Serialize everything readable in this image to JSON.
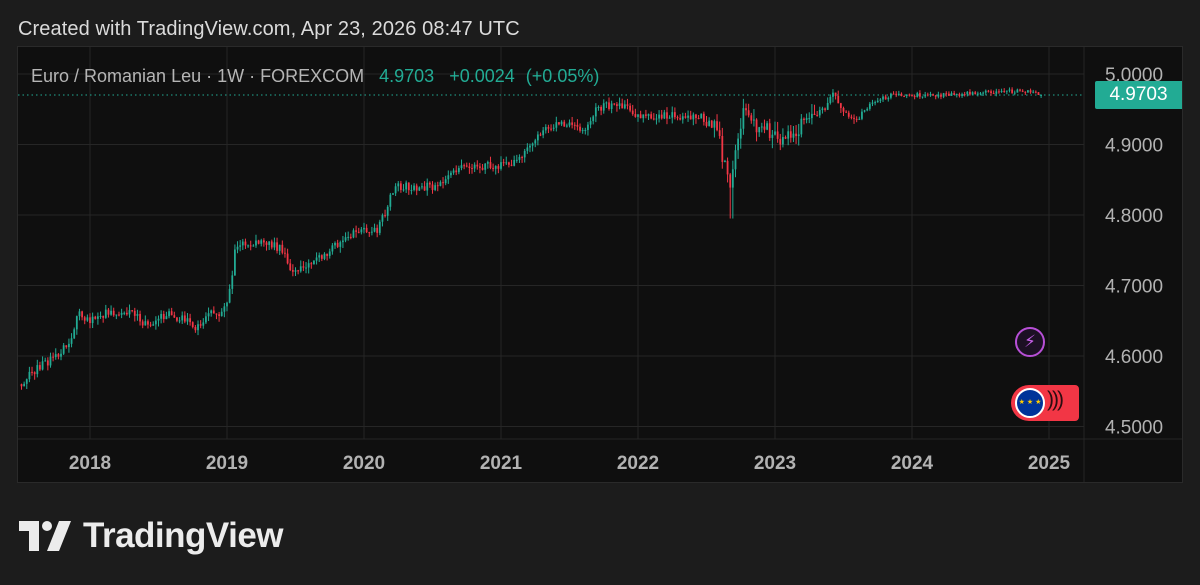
{
  "caption": "Created with TradingView.com, Apr 23, 2026 08:47 UTC",
  "legend": {
    "symbol": "Euro / Romanian Leu · 1W · FOREXCOM",
    "price": "4.9703",
    "change": "+0.0024",
    "change_pct": "(+0.05%)"
  },
  "last_price_label": "4.9703",
  "brand": "TradingView",
  "colors": {
    "up": "#22ab94",
    "down": "#f23645",
    "grid": "#262626",
    "axis_text": "#b2b2b2",
    "panel": "#0f0f0f",
    "page": "#1c1c1c"
  },
  "icons": [
    "lightning-bolt-icon",
    "eu-flag-icon",
    "tradingview-logo-icon"
  ],
  "chart_data": {
    "type": "candlestick",
    "title": "Euro / Romanian Leu",
    "interval": "1W",
    "source": "FOREXCOM",
    "ylim": [
      4.48,
      5.02
    ],
    "y_ticks": [
      4.5,
      4.6,
      4.7,
      4.8,
      4.9,
      5.0
    ],
    "y_tick_labels": [
      "4.5000",
      "4.6000",
      "4.7000",
      "4.8000",
      "4.9000",
      "5.0000"
    ],
    "x_range": [
      2017.48,
      2025.45
    ],
    "x_ticks": [
      2018,
      2019,
      2020,
      2021,
      2022,
      2023,
      2024,
      2025
    ],
    "x_tick_labels": [
      "2018",
      "2019",
      "2020",
      "2021",
      "2022",
      "2023",
      "2024",
      "2025"
    ],
    "last_price": 4.9703,
    "grid": true,
    "price_path": [
      [
        2017.5,
        4.56
      ],
      [
        2017.6,
        4.58
      ],
      [
        2017.75,
        4.6
      ],
      [
        2017.85,
        4.62
      ],
      [
        2017.92,
        4.66
      ],
      [
        2018.0,
        4.65
      ],
      [
        2018.1,
        4.66
      ],
      [
        2018.3,
        4.66
      ],
      [
        2018.45,
        4.64
      ],
      [
        2018.55,
        4.66
      ],
      [
        2018.7,
        4.65
      ],
      [
        2018.78,
        4.64
      ],
      [
        2018.88,
        4.66
      ],
      [
        2018.96,
        4.66
      ],
      [
        2019.02,
        4.69
      ],
      [
        2019.06,
        4.75
      ],
      [
        2019.12,
        4.76
      ],
      [
        2019.3,
        4.76
      ],
      [
        2019.42,
        4.75
      ],
      [
        2019.47,
        4.72
      ],
      [
        2019.6,
        4.73
      ],
      [
        2019.75,
        4.75
      ],
      [
        2019.88,
        4.77
      ],
      [
        2020.05,
        4.78
      ],
      [
        2020.1,
        4.78
      ],
      [
        2020.15,
        4.8
      ],
      [
        2020.2,
        4.83
      ],
      [
        2020.25,
        4.84
      ],
      [
        2020.4,
        4.84
      ],
      [
        2020.55,
        4.84
      ],
      [
        2020.7,
        4.87
      ],
      [
        2020.9,
        4.87
      ],
      [
        2021.05,
        4.87
      ],
      [
        2021.15,
        4.88
      ],
      [
        2021.25,
        4.91
      ],
      [
        2021.3,
        4.92
      ],
      [
        2021.45,
        4.93
      ],
      [
        2021.6,
        4.92
      ],
      [
        2021.7,
        4.95
      ],
      [
        2021.85,
        4.96
      ],
      [
        2022.0,
        4.94
      ],
      [
        2022.2,
        4.94
      ],
      [
        2022.45,
        4.94
      ],
      [
        2022.58,
        4.92
      ],
      [
        2022.63,
        4.87
      ],
      [
        2022.67,
        4.84
      ],
      [
        2022.72,
        4.91
      ],
      [
        2022.78,
        4.95
      ],
      [
        2022.88,
        4.92
      ],
      [
        2022.95,
        4.92
      ],
      [
        2023.05,
        4.9
      ],
      [
        2023.15,
        4.92
      ],
      [
        2023.25,
        4.94
      ],
      [
        2023.35,
        4.95
      ],
      [
        2023.42,
        4.97
      ],
      [
        2023.5,
        4.95
      ],
      [
        2023.58,
        4.93
      ],
      [
        2023.66,
        4.95
      ],
      [
        2023.72,
        4.96
      ],
      [
        2023.85,
        4.97
      ],
      [
        2024.0,
        4.97
      ],
      [
        2024.3,
        4.97
      ],
      [
        2024.6,
        4.975
      ],
      [
        2024.8,
        4.976
      ],
      [
        2024.9,
        4.972
      ],
      [
        2024.95,
        4.9703
      ]
    ]
  }
}
